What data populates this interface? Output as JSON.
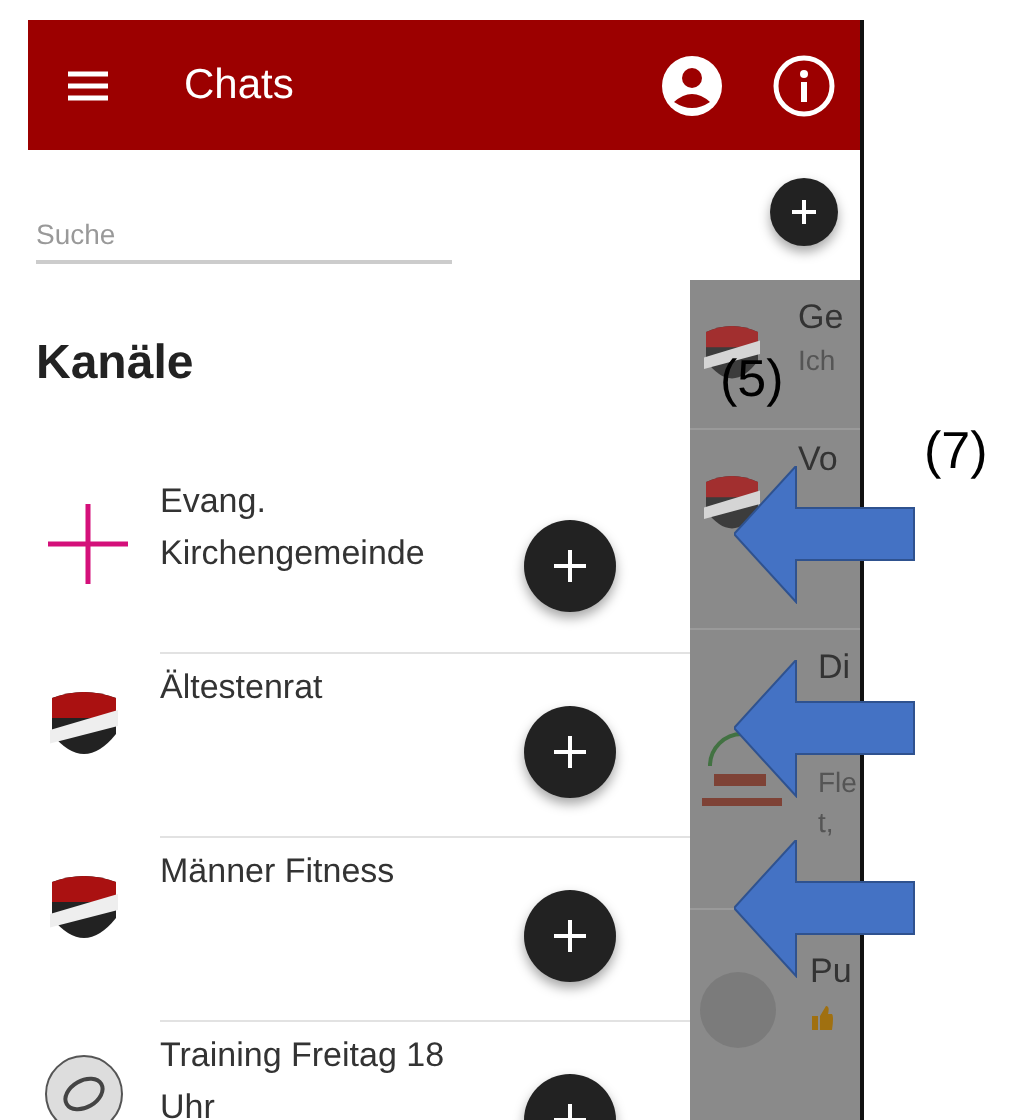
{
  "app_bar": {
    "title": "Chats"
  },
  "search": {
    "placeholder": "Suche"
  },
  "section_title": "Kanäle",
  "channels": [
    {
      "name": "Evang. Kirchengemeinde",
      "kind": "cross"
    },
    {
      "name": "Ältestenrat",
      "kind": "shield"
    },
    {
      "name": "Männer Fitness",
      "kind": "shield"
    },
    {
      "name": "Training Freitag 18 Uhr",
      "kind": "tennis"
    }
  ],
  "background_chats": [
    {
      "kind": "shield",
      "lines": [
        "Ge",
        "Ich"
      ]
    },
    {
      "kind": "shield",
      "lines": [
        "Vo"
      ]
    },
    {
      "kind": "farm",
      "lines": [
        "Di",
        "Fle",
        "t,"
      ]
    },
    {
      "kind": "avatar",
      "lines": [
        "Pu"
      ]
    }
  ],
  "annotations": {
    "labels": [
      "(5)",
      "(7)"
    ]
  }
}
